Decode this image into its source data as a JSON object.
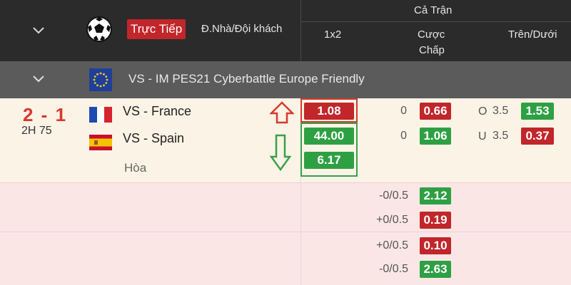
{
  "header": {
    "live_label": "Trực Tiếp",
    "home_away_label": "Đ.Nhà/Đội khách",
    "full_match_label": "Cả Trận",
    "col_1x2": "1x2",
    "col_handicap_line1": "Cược",
    "col_handicap_line2": "Chấp",
    "col_over_under": "Trên/Dưới"
  },
  "league": {
    "title": "VS - IM PES21 Cyberbattle Europe Friendly"
  },
  "match": {
    "score": "2 - 1",
    "minute": "2H 75",
    "home_team": "VS - France",
    "away_team": "VS - Spain",
    "draw_label": "Hòa",
    "odds_1x2": {
      "home": "1.08",
      "away": "44.00",
      "draw": "6.17"
    },
    "handicap": {
      "home_line": "0",
      "home_odds": "0.66",
      "away_line": "0",
      "away_odds": "1.06"
    },
    "over_under": {
      "over_prefix": "O",
      "over_line": "3.5",
      "over_odds": "1.53",
      "under_prefix": "U",
      "under_line": "3.5",
      "under_odds": "0.37"
    }
  },
  "extra_lines": [
    {
      "line": "-0/0.5",
      "odds": "2.12"
    },
    {
      "line": "+0/0.5",
      "odds": "0.19"
    },
    {
      "line": "+0/0.5",
      "odds": "0.10"
    },
    {
      "line": "-0/0.5",
      "odds": "2.63"
    }
  ],
  "colors": {
    "up": "#c0262a",
    "down": "#2ea043",
    "header_bg": "#2b2b2b",
    "league_bg": "#5b5b5b"
  }
}
